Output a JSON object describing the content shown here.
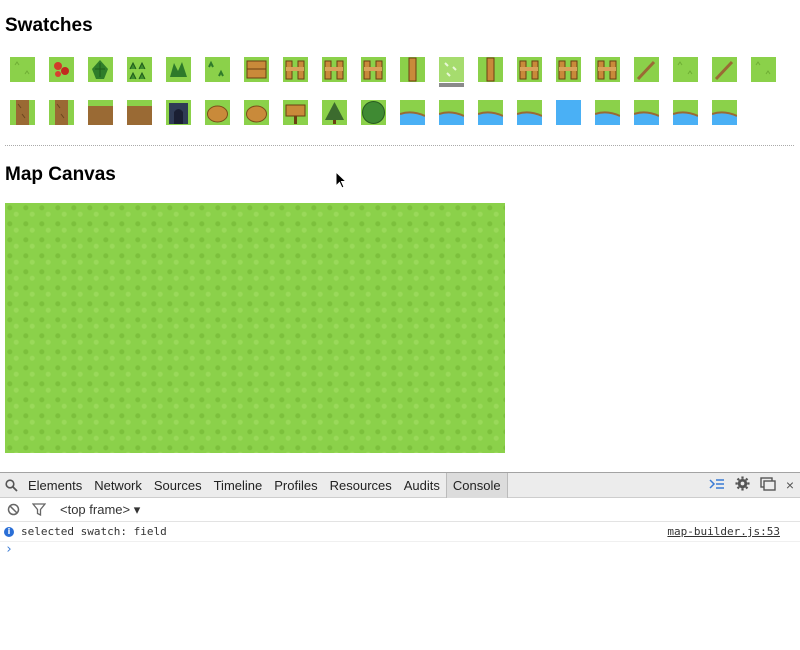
{
  "sections": {
    "swatches_title": "Swatches",
    "canvas_title": "Map Canvas"
  },
  "swatches_row1": [
    {
      "name": "field-plain",
      "kind": "grass"
    },
    {
      "name": "flowers",
      "kind": "flowers"
    },
    {
      "name": "bush-large",
      "kind": "bush"
    },
    {
      "name": "tall-grass",
      "kind": "tallgrass"
    },
    {
      "name": "shrub",
      "kind": "shrub"
    },
    {
      "name": "grass-tufts",
      "kind": "tufts"
    },
    {
      "name": "crate",
      "kind": "crate"
    },
    {
      "name": "fence-a",
      "kind": "fence"
    },
    {
      "name": "fence-b",
      "kind": "fence"
    },
    {
      "name": "fence-c",
      "kind": "fence"
    },
    {
      "name": "fence-post",
      "kind": "post"
    },
    {
      "name": "field",
      "kind": "field",
      "selected": true
    },
    {
      "name": "fence-post-b",
      "kind": "post"
    },
    {
      "name": "fence-d",
      "kind": "fence"
    },
    {
      "name": "fence-e",
      "kind": "fence"
    },
    {
      "name": "fence-f",
      "kind": "fence"
    },
    {
      "name": "cliff-edge-a",
      "kind": "cliff"
    },
    {
      "name": "grass-edge",
      "kind": "grass"
    },
    {
      "name": "cliff-edge-b",
      "kind": "cliff"
    },
    {
      "name": "grass-plain-b",
      "kind": "grass"
    }
  ],
  "swatches_row2": [
    {
      "name": "cliff-left",
      "kind": "cliffside"
    },
    {
      "name": "cliff-corner",
      "kind": "cliffside"
    },
    {
      "name": "dirt-a",
      "kind": "dirt"
    },
    {
      "name": "dirt-b",
      "kind": "dirt"
    },
    {
      "name": "cave",
      "kind": "cave"
    },
    {
      "name": "rock-a",
      "kind": "rock"
    },
    {
      "name": "rock-b",
      "kind": "rock"
    },
    {
      "name": "sign",
      "kind": "sign"
    },
    {
      "name": "tree-small",
      "kind": "tree"
    },
    {
      "name": "tree-round",
      "kind": "roundtree"
    },
    {
      "name": "water-corner-a",
      "kind": "water"
    },
    {
      "name": "water-edge-a",
      "kind": "water"
    },
    {
      "name": "water-corner-b",
      "kind": "water"
    },
    {
      "name": "water-edge-b",
      "kind": "water"
    },
    {
      "name": "water-plain",
      "kind": "waterfull"
    },
    {
      "name": "water-edge-c",
      "kind": "water"
    },
    {
      "name": "water-corner-c",
      "kind": "water"
    },
    {
      "name": "water-corner-d",
      "kind": "water"
    },
    {
      "name": "water-corner-e",
      "kind": "water"
    }
  ],
  "devtools": {
    "tabs": [
      "Elements",
      "Network",
      "Sources",
      "Timeline",
      "Profiles",
      "Resources",
      "Audits",
      "Console"
    ],
    "active_tab": "Console",
    "frame_selector": "<top frame>",
    "console_message": "selected swatch: field",
    "console_source": "map-builder.js:53",
    "colors": {
      "accent": "#3a7bd5",
      "info": "#2b6fd6"
    }
  },
  "colors": {
    "grass": "#8bd14a",
    "water": "#4ab0f5",
    "dirt": "#9a6a34",
    "wood": "#c98a3a"
  }
}
